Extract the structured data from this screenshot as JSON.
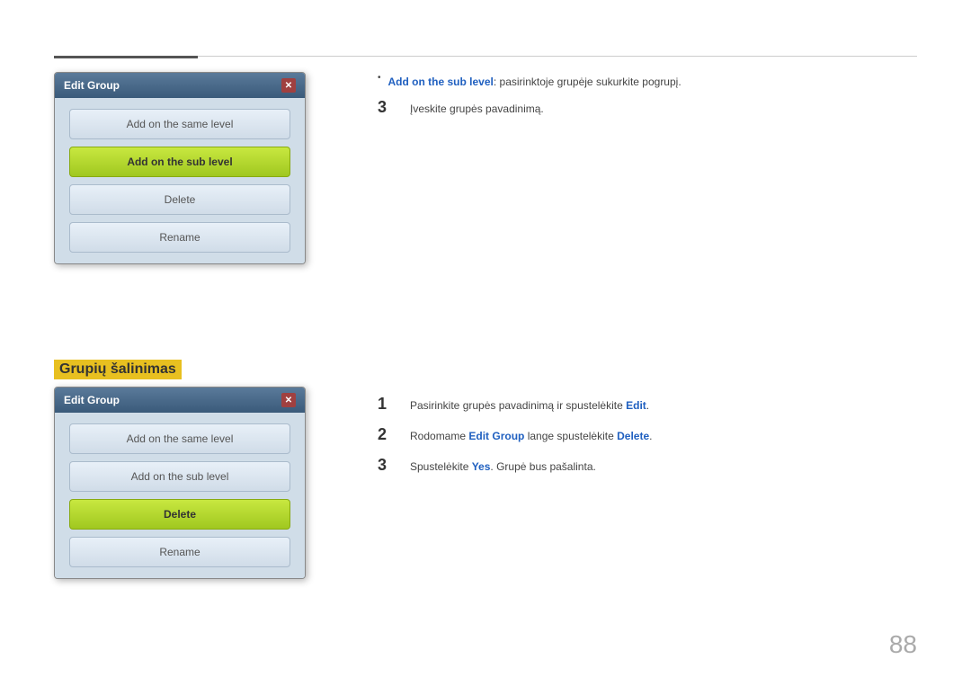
{
  "page": {
    "number": "88"
  },
  "top_rule": true,
  "section_top": {
    "dialog": {
      "title": "Edit Group",
      "buttons": [
        {
          "label": "Add on the same level",
          "type": "normal"
        },
        {
          "label": "Add on the sub level",
          "type": "green"
        },
        {
          "label": "Delete",
          "type": "normal"
        },
        {
          "label": "Rename",
          "type": "normal"
        }
      ]
    },
    "right": {
      "bullet": {
        "link": "Add on the sub level",
        "text": ": pasirinktoje grupėje sukurkite pogrupį."
      },
      "step3": {
        "number": "3",
        "text": "Įveskite grupės pavadinimą."
      }
    }
  },
  "section_heading": {
    "text": "Grupių šalinimas"
  },
  "section_bottom": {
    "dialog": {
      "title": "Edit Group",
      "buttons": [
        {
          "label": "Add on the same level",
          "type": "normal"
        },
        {
          "label": "Add on the sub level",
          "type": "normal"
        },
        {
          "label": "Delete",
          "type": "green"
        },
        {
          "label": "Rename",
          "type": "normal"
        }
      ]
    },
    "right": {
      "step1": {
        "number": "1",
        "text_before": "Pasirinkite grupės pavadinimą ir spustelėkite ",
        "link": "Edit",
        "text_after": "."
      },
      "step2": {
        "number": "2",
        "text_before": "Rodomame ",
        "link1": "Edit Group",
        "text_middle": " lange spustelėkite ",
        "link2": "Delete",
        "text_after": "."
      },
      "step3": {
        "number": "3",
        "text_before": "Spustelėkite ",
        "link": "Yes",
        "text_after": ". Grupė bus pašalinta."
      }
    }
  }
}
